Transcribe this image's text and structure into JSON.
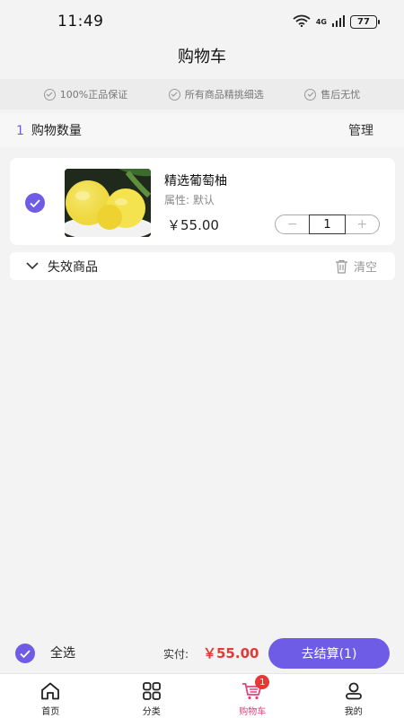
{
  "status": {
    "time": "11:49",
    "network": "4G",
    "battery": "77"
  },
  "header": {
    "title": "购物车"
  },
  "guarantees": [
    {
      "icon": "check-circle-icon",
      "label": "100%正品保证"
    },
    {
      "icon": "check-circle-icon",
      "label": "所有商品精挑细选"
    },
    {
      "icon": "check-circle-icon",
      "label": "售后无忧"
    }
  ],
  "cart": {
    "count": "1",
    "count_label": "购物数量",
    "manage_label": "管理",
    "items": [
      {
        "name": "精选葡萄柚",
        "attr": "属性:  默认",
        "price": "￥55.00",
        "quantity": "1",
        "minus": "−",
        "plus": "+"
      }
    ],
    "invalid": {
      "label": "失效商品",
      "clear_label": "清空"
    }
  },
  "checkout": {
    "select_all_label": "全选",
    "total_label": "实付:",
    "total_value": "￥55.00",
    "button_label": "去结算(1)"
  },
  "tabbar": {
    "tabs": [
      {
        "label": "首页",
        "icon": "home-icon"
      },
      {
        "label": "分类",
        "icon": "grid-icon"
      },
      {
        "label": "购物车",
        "icon": "cart-icon",
        "badge": "1"
      },
      {
        "label": "我的",
        "icon": "user-icon"
      }
    ]
  },
  "colors": {
    "accent": "#6e5ce6",
    "price": "#e53935",
    "active_tab": "#e0407a"
  }
}
